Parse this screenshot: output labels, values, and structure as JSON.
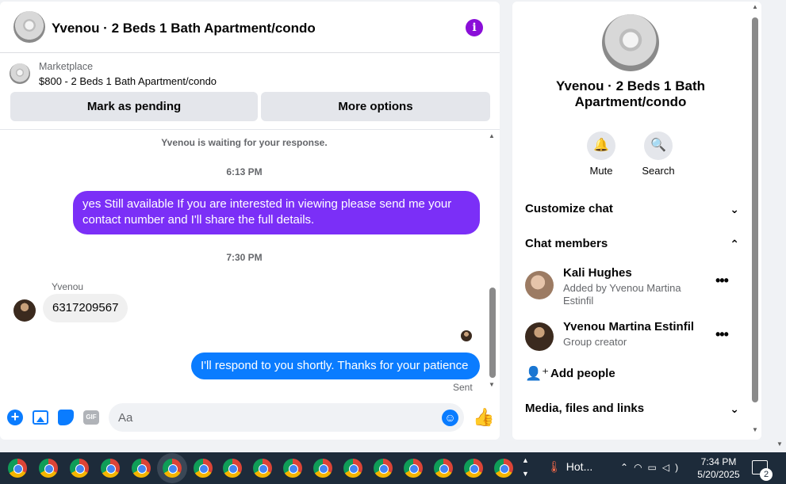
{
  "chat": {
    "title": "Yvenou · 2 Beds 1 Bath Apartment/condo",
    "info_icon": "info-icon",
    "marketplace": {
      "label": "Marketplace",
      "listing": "$800 - 2 Beds 1 Bath Apartment/condo",
      "mark_pending": "Mark as pending",
      "more_options": "More options"
    },
    "messages": {
      "waiting": "Yvenou is waiting for your response.",
      "time1": "6:13 PM",
      "outgoing1": "yes Still available If you are interested in viewing please send me your contact number and I'll share the full details.",
      "time2": "7:30 PM",
      "sender": "Yvenou",
      "incoming1": "6317209567",
      "outgoing2": "I'll respond to you shortly. Thanks for your patience",
      "status": "Sent"
    },
    "composer": {
      "placeholder": "Aa"
    },
    "colors": {
      "accent_blue": "#0a7cff",
      "accent_purple": "#7b2ff7",
      "info_purple": "#8a0ed8"
    }
  },
  "info": {
    "title": "Yvenou · 2 Beds 1 Bath Apartment/condo",
    "actions": [
      {
        "label": "Mute",
        "icon": "bell-icon"
      },
      {
        "label": "Search",
        "icon": "search-icon"
      }
    ],
    "sections": {
      "customize": "Customize chat",
      "members": "Chat members",
      "media": "Media, files and links"
    },
    "members": [
      {
        "name": "Kali Hughes",
        "subtitle": "Added by Yvenou Martina Estinfil"
      },
      {
        "name": "Yvenou Martina Estinfil",
        "subtitle": "Group creator"
      }
    ],
    "add_people": "Add people"
  },
  "taskbar": {
    "weather": "Hot...",
    "time": "7:34 PM",
    "date": "5/20/2025",
    "notifications": "2"
  }
}
